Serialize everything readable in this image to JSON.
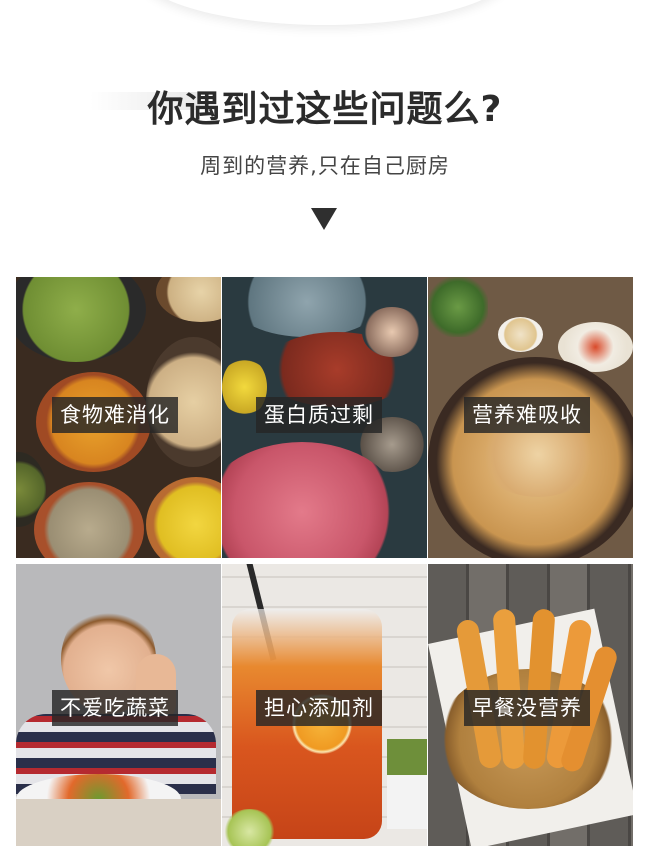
{
  "header": {
    "title": "你遇到过这些问题么?",
    "subtitle": "周到的营养,只在自己厨房"
  },
  "problems": [
    {
      "label": "食物难消化",
      "image": "bowls of grains and legumes"
    },
    {
      "label": "蛋白质过剩",
      "image": "lobster, octopus and shellfish"
    },
    {
      "label": "营养难吸收",
      "image": "chicken soup in clay pot"
    },
    {
      "label": "不爱吃蔬菜",
      "image": "boy refusing vegetables"
    },
    {
      "label": "担心添加剂",
      "image": "iced drink in plastic pouch"
    },
    {
      "label": "早餐没营养",
      "image": "fried dough sticks in basket"
    }
  ],
  "colors": {
    "title": "#2b2b2b",
    "subtitle": "#444444",
    "label_bg": "#262626",
    "label_text": "#ffffff"
  }
}
